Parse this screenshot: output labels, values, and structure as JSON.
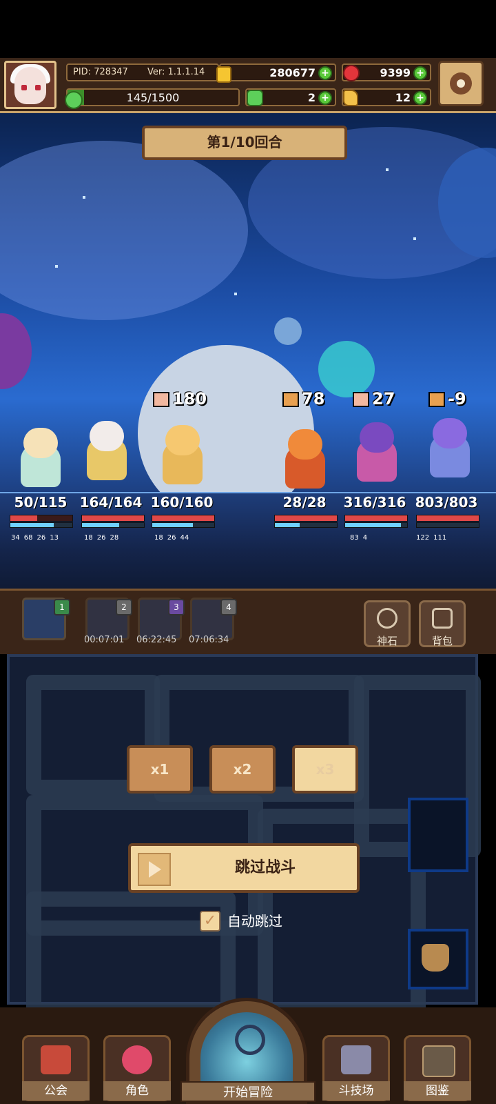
{
  "header": {
    "pid_label": "PID: 728347",
    "version_label": "Ver: 1.1.1.14",
    "gold": "280677",
    "rubies": "9399",
    "exp_progress": "145/1500",
    "exp_fraction": 0.0967,
    "clovers": "2",
    "hands": "12"
  },
  "battle": {
    "round_label": "第1/10回合",
    "allies": [
      {
        "hp": "50/115",
        "hp_frac": 0.43,
        "stats": [
          "34",
          "68",
          "26",
          "13"
        ]
      },
      {
        "hp": "164/164",
        "hp_frac": 1.0,
        "stats": [
          "18",
          "26",
          "28"
        ]
      },
      {
        "hp": "160/160",
        "hp_frac": 1.0,
        "stats": [
          "18",
          "26",
          "44"
        ],
        "damage": "180"
      }
    ],
    "enemies": [
      {
        "hp": "28/28",
        "hp_frac": 1.0,
        "stats": [],
        "damage": "78"
      },
      {
        "hp": "316/316",
        "hp_frac": 1.0,
        "stats": [
          "83",
          "4"
        ],
        "damage": "27"
      },
      {
        "hp": "803/803",
        "hp_frac": 1.0,
        "stats": [
          "122",
          "111"
        ],
        "damage": "-9"
      }
    ]
  },
  "team": {
    "slots": [
      {
        "num": "1",
        "timer": ""
      },
      {
        "num": "2",
        "timer": "00:07:01"
      },
      {
        "num": "3",
        "timer": "06:22:45"
      },
      {
        "num": "4",
        "timer": "07:06:34"
      }
    ],
    "god_stone_label": "神石",
    "backpack_label": "背包"
  },
  "controls": {
    "speed_labels": [
      "x1",
      "x2",
      "x3"
    ],
    "skip_label": "跳过战斗",
    "auto_skip_label": "自动跳过"
  },
  "nav": {
    "guild": "公会",
    "character": "角色",
    "start_adventure": "开始冒险",
    "arena": "斗技场",
    "codex": "图鉴"
  },
  "colors": {
    "accent": "#f2d7a0",
    "panel": "#3a2518",
    "hp": "#e04848",
    "mp": "#6fd0ff"
  }
}
